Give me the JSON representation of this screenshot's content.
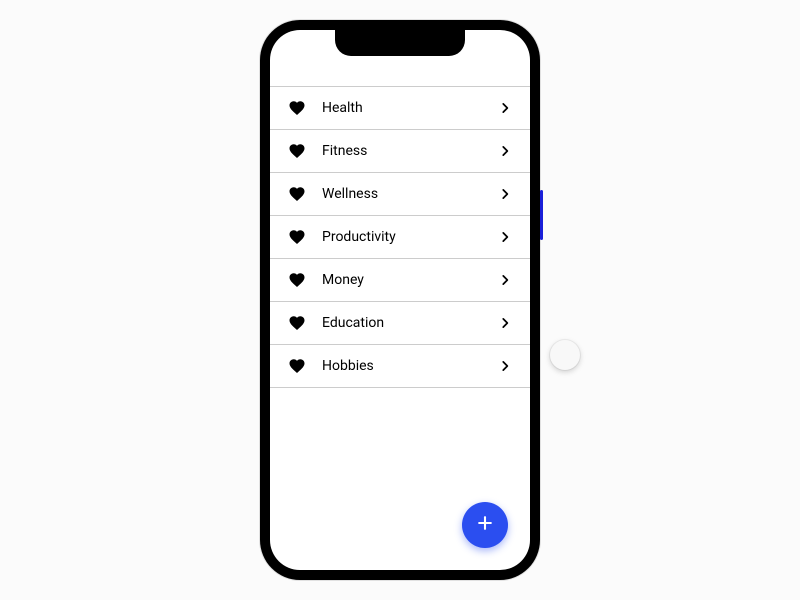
{
  "categories": [
    {
      "label": "Health"
    },
    {
      "label": "Fitness"
    },
    {
      "label": "Wellness"
    },
    {
      "label": "Productivity"
    },
    {
      "label": "Money"
    },
    {
      "label": "Education"
    },
    {
      "label": "Hobbies"
    }
  ],
  "fab": {
    "color": "#2b4ef0",
    "icon": "plus"
  }
}
